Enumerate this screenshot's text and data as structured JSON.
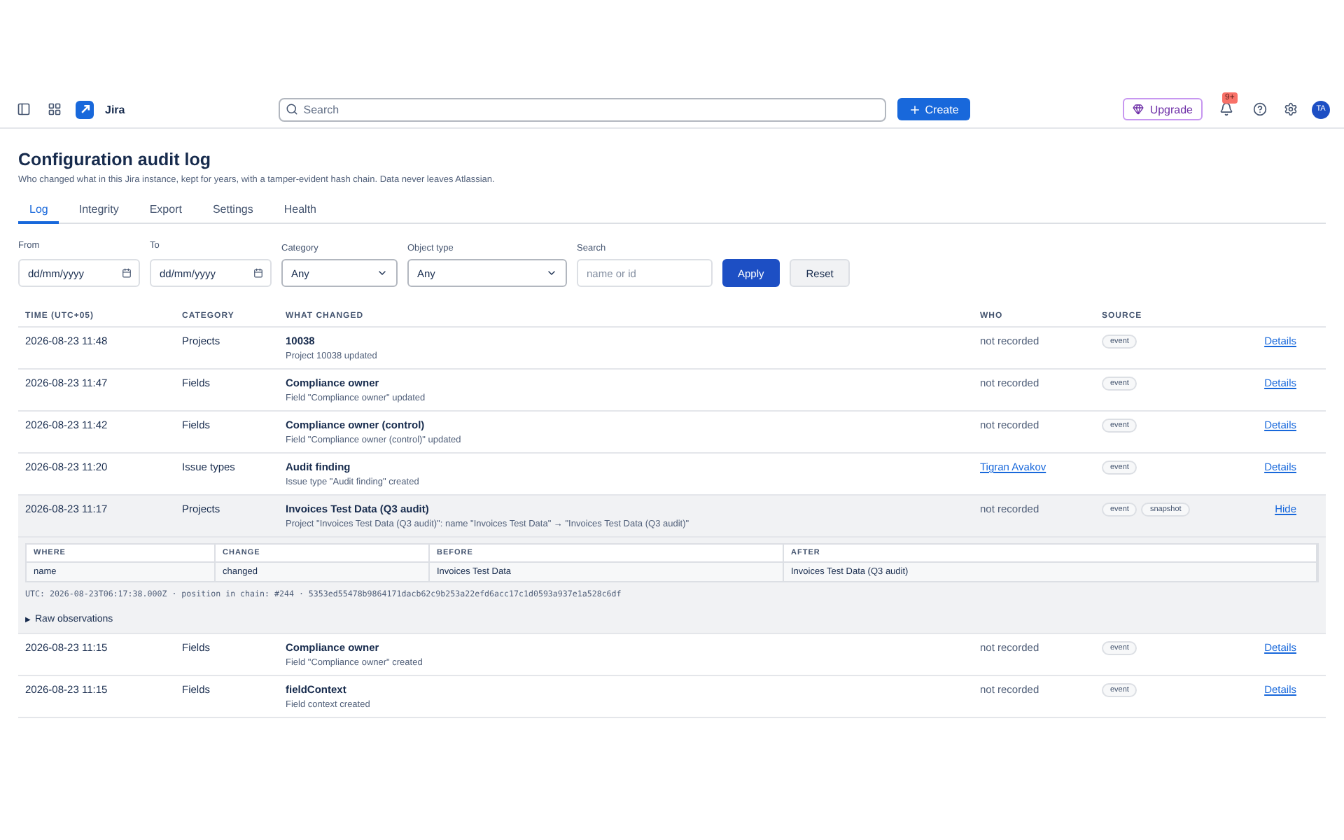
{
  "topbar": {
    "product": "Jira",
    "search": {
      "placeholder": "Search"
    },
    "create": "Create",
    "upgrade": "Upgrade",
    "notifications": "9+",
    "avatar": "TA"
  },
  "page": {
    "title": "Configuration audit log",
    "subtitle": "Who changed what in this Jira instance, kept for years, with a tamper-evident hash chain. Data never leaves Atlassian."
  },
  "tabs": [
    {
      "label": "Log",
      "selected": true
    },
    {
      "label": "Integrity",
      "selected": false
    },
    {
      "label": "Export",
      "selected": false
    },
    {
      "label": "Settings",
      "selected": false
    },
    {
      "label": "Health",
      "selected": false
    }
  ],
  "filters": [
    {
      "kind": "date",
      "label": "From",
      "placeholder": "dd/mm/yyyy"
    },
    {
      "kind": "date",
      "label": "To",
      "placeholder": "dd/mm/yyyy"
    },
    {
      "kind": "select",
      "label": "Category",
      "value": "Any"
    },
    {
      "kind": "select",
      "label": "Object type",
      "value": "Any"
    },
    {
      "kind": "text",
      "label": "Search",
      "placeholder": "name or id"
    }
  ],
  "filter_buttons": [
    {
      "label": "Apply",
      "primary": true
    },
    {
      "label": "Reset",
      "primary": false
    }
  ],
  "table": {
    "columns": [
      "TIME (UTC+05)",
      "CATEGORY",
      "WHAT CHANGED",
      "WHO",
      "SOURCE"
    ],
    "rows": [
      {
        "time": "2026-08-23 11:48",
        "category": "Projects",
        "title": "10038",
        "summary": "Project 10038 updated",
        "who": {
          "text": "not recorded",
          "linked": false
        },
        "sources": [
          "event"
        ],
        "action": "Details",
        "expanded": false
      },
      {
        "time": "2026-08-23 11:47",
        "category": "Fields",
        "title": "Compliance owner",
        "summary": "Field \"Compliance owner\" updated",
        "who": {
          "text": "not recorded",
          "linked": false
        },
        "sources": [
          "event"
        ],
        "action": "Details",
        "expanded": false
      },
      {
        "time": "2026-08-23 11:42",
        "category": "Fields",
        "title": "Compliance owner (control)",
        "summary": "Field \"Compliance owner (control)\" updated",
        "who": {
          "text": "not recorded",
          "linked": false
        },
        "sources": [
          "event"
        ],
        "action": "Details",
        "expanded": false
      },
      {
        "time": "2026-08-23 11:20",
        "category": "Issue types",
        "title": "Audit finding",
        "summary": "Issue type \"Audit finding\" created",
        "who": {
          "text": "Tigran Avakov",
          "linked": true
        },
        "sources": [
          "event"
        ],
        "action": "Details",
        "expanded": false
      },
      {
        "time": "2026-08-23 11:17",
        "category": "Projects",
        "title": "Invoices Test Data (Q3 audit)",
        "summary": "Project \"Invoices Test Data (Q3 audit)\": name \"Invoices Test Data\" → \"Invoices Test Data (Q3 audit)\"",
        "who": {
          "text": "not recorded",
          "linked": false
        },
        "sources": [
          "event",
          "snapshot"
        ],
        "action": "Hide",
        "expanded": true,
        "detail": {
          "columns": [
            "WHERE",
            "CHANGE",
            "BEFORE",
            "AFTER"
          ],
          "rows": [
            [
              "name",
              "changed",
              "Invoices Test Data",
              "Invoices Test Data (Q3 audit)"
            ]
          ],
          "chain": "UTC: 2026-08-23T06:17:38.000Z · position in chain: #244 · 5353ed55478b9864171dacb62c9b253a22efd6acc17c1d0593a937e1a528c6df",
          "raw": {
            "marker": "▶",
            "label": "Raw observations",
            "expanded": false
          }
        }
      },
      {
        "time": "2026-08-23 11:15",
        "category": "Fields",
        "title": "Compliance owner",
        "summary": "Field \"Compliance owner\" created",
        "who": {
          "text": "not recorded",
          "linked": false
        },
        "sources": [
          "event"
        ],
        "action": "Details",
        "expanded": false
      },
      {
        "time": "2026-08-23 11:15",
        "category": "Fields",
        "title": "fieldContext",
        "summary": "Field context created",
        "who": {
          "text": "not recorded",
          "linked": false
        },
        "sources": [
          "event"
        ],
        "action": "Details",
        "expanded": false
      }
    ]
  }
}
